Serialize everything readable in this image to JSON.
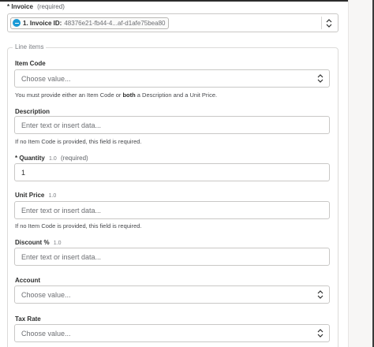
{
  "invoice": {
    "star": "*",
    "label": "Invoice",
    "required": "(required)",
    "pill_label": "1. Invoice ID:",
    "pill_value": "48376e21-fb44-4...af-d1afe75bea80"
  },
  "line_items": {
    "legend": "Line items",
    "item_code": {
      "label": "Item Code",
      "placeholder": "Choose value...",
      "help_pre": "You must provide either an Item Code or ",
      "help_bold": "both",
      "help_post": " a Description and a Unit Price."
    },
    "description": {
      "label": "Description",
      "placeholder": "Enter text or insert data...",
      "help": "If no Item Code is provided, this field is required."
    },
    "quantity": {
      "star": "*",
      "label": "Quantity",
      "version": "1.0",
      "required": "(required)",
      "value": "1"
    },
    "unit_price": {
      "label": "Unit Price",
      "version": "1.0",
      "placeholder": "Enter text or insert data...",
      "help": "If no Item Code is provided, this field is required."
    },
    "discount": {
      "label": "Discount %",
      "version": "1.0",
      "placeholder": "Enter text or insert data..."
    },
    "account": {
      "label": "Account",
      "placeholder": "Choose value..."
    },
    "tax_rate": {
      "label": "Tax Rate",
      "placeholder": "Choose value..."
    }
  },
  "colors": {
    "accent": "#1a9ad6",
    "border": "#c9c8c6",
    "text": "#2d2e2e"
  }
}
